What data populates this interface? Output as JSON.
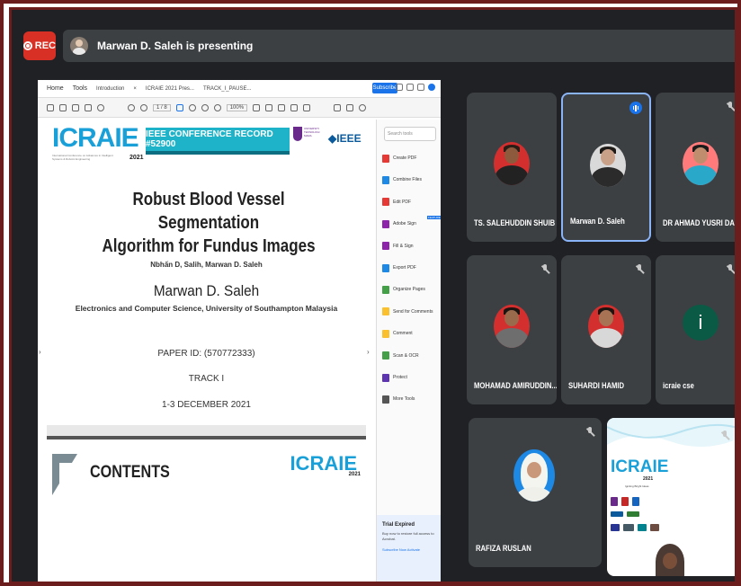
{
  "recording": {
    "label": "REC"
  },
  "presenting_banner": {
    "text": "Marwan D. Saleh is presenting"
  },
  "shared_screen": {
    "browser_tabs": [
      "Home",
      "Tools",
      "Introduction",
      "ICRAIE 2021 Pres...",
      "TRACK_I_PAUSE..."
    ],
    "subscribe_label": "Subscribe",
    "page_indicator": "1 / 8",
    "zoom_label": "100%"
  },
  "pdf": {
    "logo": "ICRAIE",
    "logo_year": "2021",
    "logo_subtitle": "International Conference on Advances in Intelligent Systems & Robotic Engineering",
    "ieee_record": "IEEE CONFERENCE RECORD #52900",
    "uitm_text": "UNIVERSITI TEKNOLOGI MARA",
    "ieee_logo": "◆IEEE",
    "title_line1": "Robust Blood Vessel Segmentation",
    "title_line2": "Algorithm for Fundus Images",
    "authors": "Nbhấn D, Salih, Marwan D. Saleh",
    "presenter": "Marwan D. Saleh",
    "affiliation": "Electronics and Computer Science, University of Southampton Malaysia",
    "paper_id": "PAPER ID: (570772333)",
    "track": "TRACK I",
    "dates": "1-3 DECEMBER 2021",
    "page2_heading": "CONTENTS",
    "page2_logo": "ICRAIE",
    "page2_year": "2021"
  },
  "tools_panel": {
    "search_placeholder": "Search tools",
    "items": [
      {
        "label": "Create PDF",
        "color": "#e53935"
      },
      {
        "label": "Combine Files",
        "color": "#1e88e5"
      },
      {
        "label": "Edit PDF",
        "color": "#e53935"
      },
      {
        "label": "Adobe Sign",
        "color": "#8e24aa"
      },
      {
        "label": "Fill & Sign",
        "color": "#8e24aa"
      },
      {
        "label": "Export PDF",
        "color": "#1e88e5"
      },
      {
        "label": "Organize Pages",
        "color": "#43a047"
      },
      {
        "label": "Send for Comments",
        "color": "#fbc02d"
      },
      {
        "label": "Comment",
        "color": "#fbc02d"
      },
      {
        "label": "Scan & OCR",
        "color": "#43a047"
      },
      {
        "label": "Protect",
        "color": "#5e35b1"
      },
      {
        "label": "More Tools",
        "color": "#555555"
      }
    ],
    "featured_badge": "FEATURED",
    "trial_title": "Trial Expired",
    "trial_desc": "Buy now to restore full access to Acrobat.",
    "trial_links": "Subscribe Now   Activate"
  },
  "participants": [
    {
      "name": "TS. SALEHUDDIN SHUIB",
      "muted": false,
      "speaking": false
    },
    {
      "name": "Marwan D. Saleh",
      "muted": false,
      "speaking": true
    },
    {
      "name": "DR AHMAD YUSRI DAK",
      "muted": true,
      "speaking": false
    },
    {
      "name": "MOHAMAD AMIRUDDIN...",
      "muted": true,
      "speaking": false
    },
    {
      "name": "SUHARDI HAMID",
      "muted": true,
      "speaking": false
    },
    {
      "name": "icraie cse",
      "muted": true,
      "speaking": false,
      "initial": "i"
    },
    {
      "name": "RAFIZA RUSLAN",
      "muted": true,
      "speaking": false
    },
    {
      "name": "",
      "muted": true,
      "speaking": false
    }
  ],
  "video_tile": {
    "logo": "ICRAIE",
    "logo_year": "2021",
    "subtitle": "Igniting Bright Ideas"
  }
}
